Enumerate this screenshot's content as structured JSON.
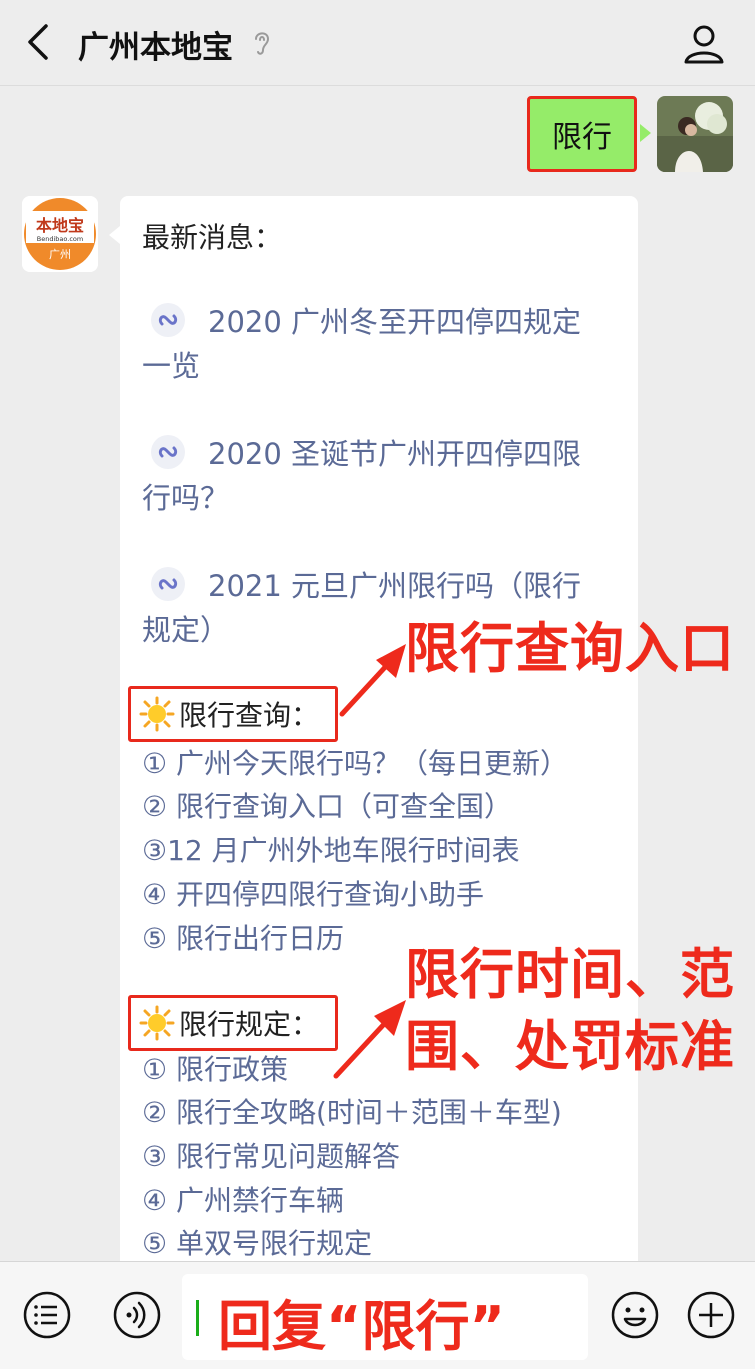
{
  "header": {
    "title": "广州本地宝",
    "back_label": "back",
    "profile_label": "profile"
  },
  "my_message": {
    "text": "限行"
  },
  "sender": {
    "avatar_top": "本地宝",
    "avatar_url_text": "Bendibao.com",
    "avatar_bottom": "广州"
  },
  "message": {
    "intro": "最新消息：",
    "links": [
      {
        "line1": "2020 广州冬至开四停四规定",
        "line2": "一览"
      },
      {
        "line1": "2020 圣诞节广州开四停四限",
        "line2": "行吗？"
      },
      {
        "line1": "2021 元旦广州限行吗（限行",
        "line2": "规定）"
      }
    ],
    "section1": {
      "title": "限行查询：",
      "items": [
        "① 广州今天限行吗？（每日更新）",
        "② 限行查询入口（可查全国）",
        "③12 月广州外地车限行时间表",
        "④ 开四停四限行查询小助手",
        "⑤ 限行出行日历"
      ]
    },
    "section2": {
      "title": "限行规定：",
      "items": [
        "① 限行政策",
        "② 限行全攻略(时间＋范围＋车型)",
        "③ 限行常见问题解答",
        "④ 广州禁行车辆",
        "⑤ 单双号限行规定"
      ]
    }
  },
  "annotations": {
    "a1": "限行查询入口",
    "a2_line1": "限行时间、范",
    "a2_line2": "围、处罚标准",
    "input_hint": "回复“限行”"
  },
  "colors": {
    "accent_red": "#ee2a1c",
    "bubble_green": "#95ec69",
    "link_blue": "#5b6a96",
    "background": "#ededed"
  },
  "icons": {
    "back": "chevron-left-icon",
    "ear": "ear-icon",
    "profile": "person-icon",
    "link": "mini-program-link-icon",
    "sun": "sun-emoji-icon",
    "menu": "menu-list-icon",
    "voice": "voice-icon",
    "emoji": "emoji-icon",
    "plus": "plus-icon"
  }
}
